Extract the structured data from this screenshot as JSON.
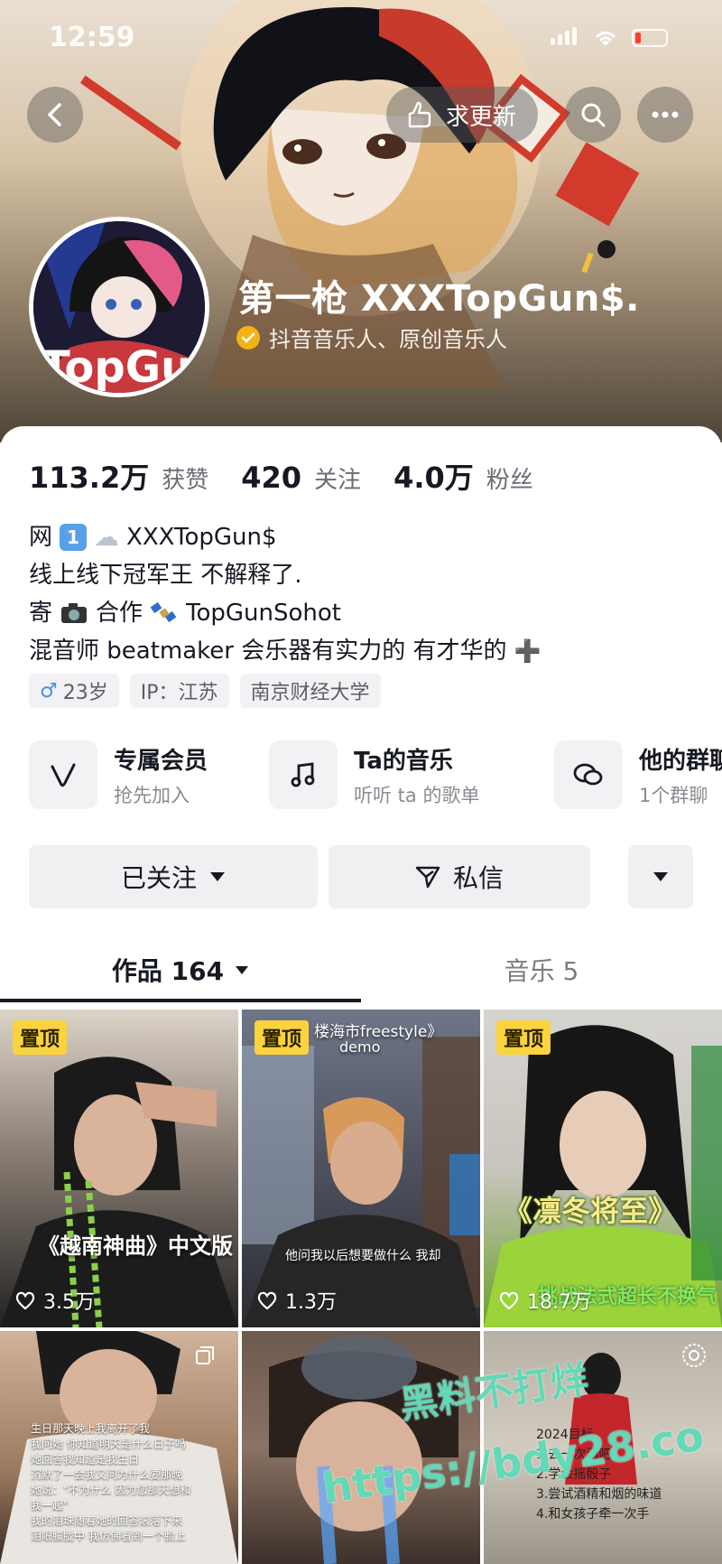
{
  "status_bar": {
    "time": "12:59"
  },
  "header": {
    "request_update_label": "求更新",
    "username": "第一枪 XXXTopGun$.",
    "verified_text": "抖音音乐人、原创音乐人"
  },
  "stats": [
    {
      "value": "113.2万",
      "label": "获赞"
    },
    {
      "value": "420",
      "label": "关注"
    },
    {
      "value": "4.0万",
      "label": "粉丝"
    }
  ],
  "bio": {
    "line1_prefix": "网",
    "line1_badge": "1",
    "line1_cloud": "☁",
    "line1_text": "XXXTopGun$",
    "line2": "线上线下冠军王 不解释了.",
    "line3_prefix": "寄",
    "line3_mid": "合作",
    "line3_text": "TopGunSohot",
    "line4": "混音师 beatmaker  会乐器有实力的 有才华的",
    "line4_plus": "➕"
  },
  "tags": {
    "gender_symbol": "♂",
    "age": "23岁",
    "ip": "IP：江苏",
    "school": "南京财经大学"
  },
  "features": [
    {
      "title": "专属会员",
      "subtitle": "抢先加入",
      "icon": "v-icon"
    },
    {
      "title": "Ta的音乐",
      "subtitle": "听听 ta 的歌单",
      "icon": "music-note-icon"
    },
    {
      "title": "他的群聊",
      "subtitle": "1个群聊",
      "icon": "chat-bubbles-icon"
    }
  ],
  "actions": {
    "followed_label": "已关注",
    "message_label": "私信"
  },
  "tabs": {
    "works_label": "作品 164",
    "music_label": "音乐 5"
  },
  "videos": [
    {
      "pinned": "置顶",
      "likes": "3.5万",
      "caption": "《越南神曲》中文版",
      "subtitle": ""
    },
    {
      "pinned": "置顶",
      "likes": "1.3万",
      "caption": "",
      "top_text1": "楼海市freestyle》",
      "top_text2": "demo",
      "subtitle": "他问我以后想要做什么 我却"
    },
    {
      "pinned": "置顶",
      "likes": "18.7万",
      "caption": "《凛冬将至》",
      "subtitle": "挑战法式超长不换气"
    },
    {
      "lines": [
        "生日那天晚上我离开了我",
        "我问她 你知道明天是什么日子吗",
        "她回答我知道是我生日",
        "沉默了一会我又问为什么要那晚",
        "她说：\"不为什么 因为您那天想和",
        "我一起\"",
        "我的泪珠随着她的回答滚落下来",
        "泪眼朦胧中 我仿佛看到一个脸上"
      ]
    },
    {
      "lines": []
    },
    {
      "lines": [
        "2024目标",
        "1.去一次酒吧",
        "2.学会摇骰子",
        "3.尝试酒精和烟的味道",
        "4.和女孩子牵一次手"
      ]
    }
  ],
  "watermark": {
    "line1": "黑料不打烊",
    "line2": "https://bdy28.co"
  },
  "colors": {
    "accent_yellow": "#fbd33d",
    "verified_badge": "#f4b315",
    "text_primary": "#161823"
  }
}
